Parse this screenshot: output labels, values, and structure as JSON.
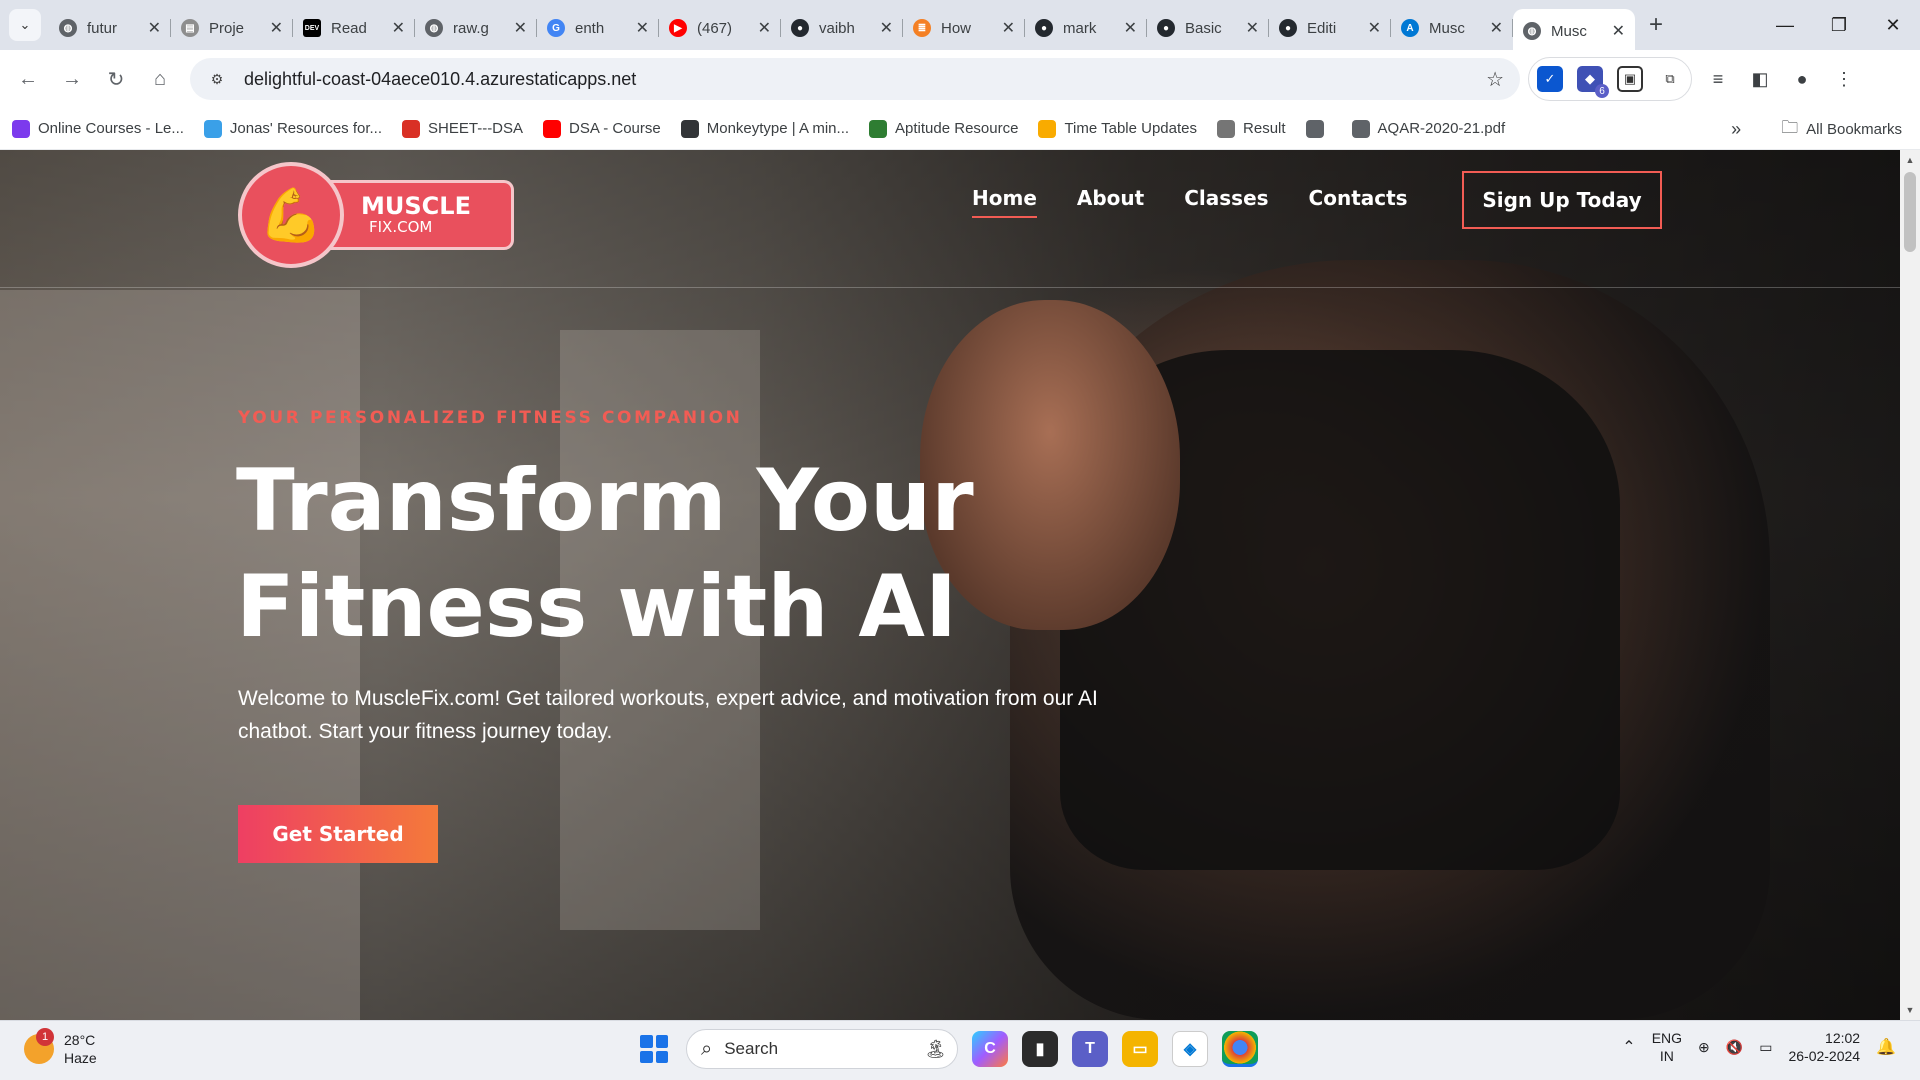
{
  "browser": {
    "tabs": [
      {
        "title": "futur",
        "favicon": "globe-icon",
        "color": "#5f6368"
      },
      {
        "title": "Proje",
        "favicon": "doc-icon",
        "color": "#8e8e8e"
      },
      {
        "title": "Read",
        "favicon": "dev-icon",
        "color": "#000000"
      },
      {
        "title": "raw.g",
        "favicon": "globe-icon",
        "color": "#5f6368"
      },
      {
        "title": "enth",
        "favicon": "google-icon",
        "color": "#4285f4"
      },
      {
        "title": "(467)",
        "favicon": "youtube-icon",
        "color": "#ff0000"
      },
      {
        "title": "vaibh",
        "favicon": "github-icon",
        "color": "#24292f"
      },
      {
        "title": "How",
        "favicon": "stack-icon",
        "color": "#f48024"
      },
      {
        "title": "mark",
        "favicon": "github-icon",
        "color": "#24292f"
      },
      {
        "title": "Basic",
        "favicon": "github-icon",
        "color": "#24292f"
      },
      {
        "title": "Editi",
        "favicon": "github-icon",
        "color": "#24292f"
      },
      {
        "title": "Musc",
        "favicon": "azure-icon",
        "color": "#0078d4"
      },
      {
        "title": "Musc",
        "favicon": "globe-icon",
        "color": "#5f6368",
        "active": true
      }
    ],
    "url": "delightful-coast-04aece010.4.azurestaticapps.net",
    "extension_badge": "6",
    "bookmarks": [
      {
        "label": "Online Courses - Le...",
        "color": "#7c3aed",
        "icon": "course-icon"
      },
      {
        "label": "Jonas' Resources for...",
        "color": "#3aa0e8",
        "icon": "heart-icon"
      },
      {
        "label": "SHEET---DSA",
        "color": "#d93025",
        "icon": "tuf-icon"
      },
      {
        "label": "DSA - Course",
        "color": "#ff0000",
        "icon": "youtube-icon"
      },
      {
        "label": "Monkeytype | A min...",
        "color": "#323437",
        "icon": "monkeytype-icon"
      },
      {
        "label": "Aptitude Resource",
        "color": "#2e7d32",
        "icon": "aptitude-icon"
      },
      {
        "label": "Time Table Updates",
        "color": "#f9ab00",
        "icon": "calendar-icon"
      },
      {
        "label": "Result",
        "color": "#757575",
        "icon": "result-icon"
      },
      {
        "label": "",
        "color": "#5f6368",
        "icon": "globe-icon"
      },
      {
        "label": "AQAR-2020-21.pdf",
        "color": "#5f6368",
        "icon": "globe-icon"
      }
    ],
    "all_bookmarks": "All Bookmarks"
  },
  "site": {
    "logo_main": "MUSCLE",
    "logo_sub": "FIX.COM",
    "nav": [
      "Home",
      "About",
      "Classes",
      "Contacts"
    ],
    "signup": "Sign Up Today",
    "tagline": "YOUR PERSONALIZED FITNESS COMPANION",
    "title_line1": "Transform Your",
    "title_line2": "Fitness with AI",
    "description": "Welcome to MuscleFix.com! Get tailored workouts, expert advice, and motivation from our AI chatbot. Start your fitness journey today.",
    "cta": "Get Started",
    "accent": "#f25c54"
  },
  "taskbar": {
    "weather_temp": "28°C",
    "weather_desc": "Haze",
    "weather_badge": "1",
    "search_placeholder": "Search",
    "lang_line1": "ENG",
    "lang_line2": "IN",
    "time": "12:02",
    "date": "26-02-2024"
  }
}
